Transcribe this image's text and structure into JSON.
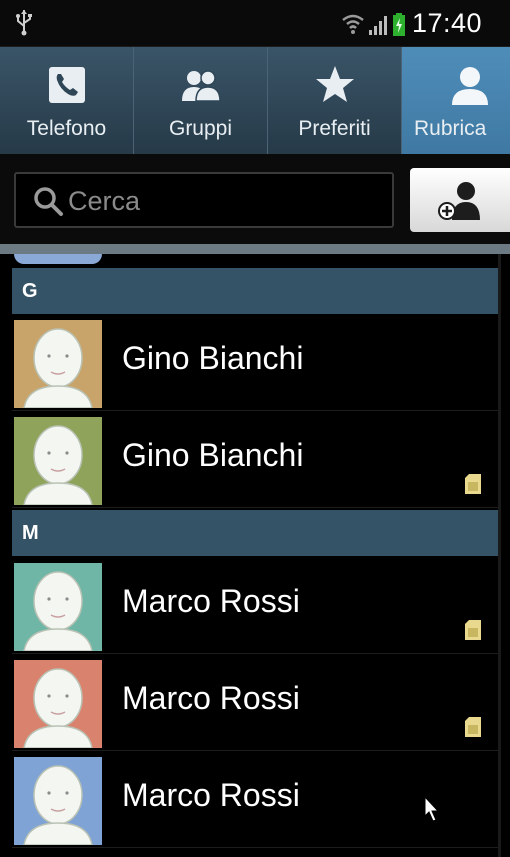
{
  "status_bar": {
    "time": "17:40",
    "icons": [
      "usb-icon",
      "wifi-icon",
      "signal-icon",
      "battery-icon"
    ]
  },
  "tabs": [
    {
      "label": "Telefono",
      "icon": "phone-icon",
      "active": false
    },
    {
      "label": "Gruppi",
      "icon": "group-icon",
      "active": false
    },
    {
      "label": "Preferiti",
      "icon": "star-icon",
      "active": false
    },
    {
      "label": "Rubrica",
      "icon": "person-icon",
      "active": true
    }
  ],
  "search": {
    "placeholder": "Cerca",
    "icon": "search-icon"
  },
  "add_contact": {
    "icon": "add-contact-icon"
  },
  "sections": [
    {
      "letter": "G",
      "contacts": [
        {
          "name": "Gino Bianchi",
          "avatar_color": "#c9a46a",
          "sim": false
        },
        {
          "name": "Gino Bianchi",
          "avatar_color": "#8fa35a",
          "sim": true
        }
      ]
    },
    {
      "letter": "M",
      "contacts": [
        {
          "name": "Marco Rossi",
          "avatar_color": "#6fb6a6",
          "sim": true
        },
        {
          "name": "Marco Rossi",
          "avatar_color": "#d9836e",
          "sim": true
        },
        {
          "name": "Marco Rossi",
          "avatar_color": "#7ea3d4",
          "sim": false
        }
      ]
    }
  ],
  "colors": {
    "tab_bar": "#2e4756",
    "tab_active": "#4a87b3",
    "section_header": "#355366",
    "background": "#000000"
  }
}
